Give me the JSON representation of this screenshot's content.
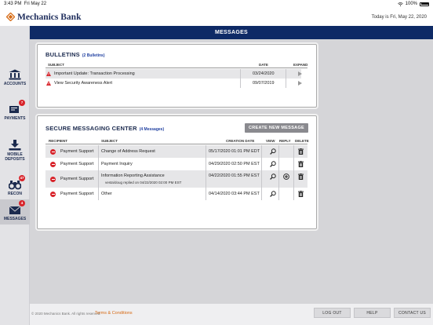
{
  "status_bar": {
    "time": "3:43 PM",
    "date": "Fri May 22",
    "battery": "100%"
  },
  "header": {
    "bank_name": "Mechanics Bank",
    "today": "Today is Fri, May 22, 2020"
  },
  "page_title": "MESSAGES",
  "sidebar": {
    "items": [
      {
        "label": "ACCOUNTS",
        "icon": "bank-icon",
        "badge": ""
      },
      {
        "label": "PAYMENTS",
        "icon": "payments-icon",
        "badge": "7"
      },
      {
        "label": "MOBILE DEPOSITS",
        "icon": "deposit-icon",
        "badge": ""
      },
      {
        "label": "RECON",
        "icon": "binoculars-icon",
        "badge": "47"
      },
      {
        "label": "MESSAGES",
        "icon": "envelope-icon",
        "badge": "4"
      }
    ]
  },
  "bulletins": {
    "title": "BULLETINS",
    "count": "(2 Bulletins)",
    "headers": {
      "subject": "SUBJECT",
      "date": "DATE",
      "expand": "EXPAND"
    },
    "rows": [
      {
        "subject": "Important Update: Transaction Processing",
        "date": "03/24/2020"
      },
      {
        "subject": "View Security Awareness Alert",
        "date": "09/07/2019"
      }
    ]
  },
  "messaging": {
    "title": "SECURE MESSAGING CENTER",
    "count": "(4 Messages)",
    "create_button": "CREATE NEW MESSAGE",
    "headers": {
      "recipient": "RECIPIENT",
      "subject": "SUBJECT",
      "creation_date": "CREATION DATE",
      "view": "VIEW",
      "reply": "REPLY",
      "delete": "DELETE"
    },
    "rows": [
      {
        "recipient": "Payment Support",
        "subject": "Change of Address Request",
        "sub_note": "",
        "date": "05/17/2020 01:01 PM EDT",
        "has_reply": false
      },
      {
        "recipient": "Payment Support",
        "subject": "Payment Inquiry",
        "sub_note": "",
        "date": "04/29/2020 02:50 PM EST",
        "has_reply": false
      },
      {
        "recipient": "Payment Support",
        "subject": "Information Reporting Assistance",
        "sub_note": "vesta/doug replied on 04/22/2020 02:00 PM EST",
        "date": "04/22/2020 01:55 PM EST",
        "has_reply": true
      },
      {
        "recipient": "Payment Support",
        "subject": "Other",
        "sub_note": "",
        "date": "04/14/2020 03:44 PM EST",
        "has_reply": false
      }
    ]
  },
  "footer": {
    "copyright": "© 2020 Mechanics Bank. All rights reserved.",
    "terms": "Terms & Conditions",
    "logout": "LOG OUT",
    "help": "HELP",
    "contact": "CONTACT US"
  },
  "colors": {
    "navy": "#0e2a66",
    "badge_red": "#d8232a",
    "terms_orange": "#d66a14"
  }
}
